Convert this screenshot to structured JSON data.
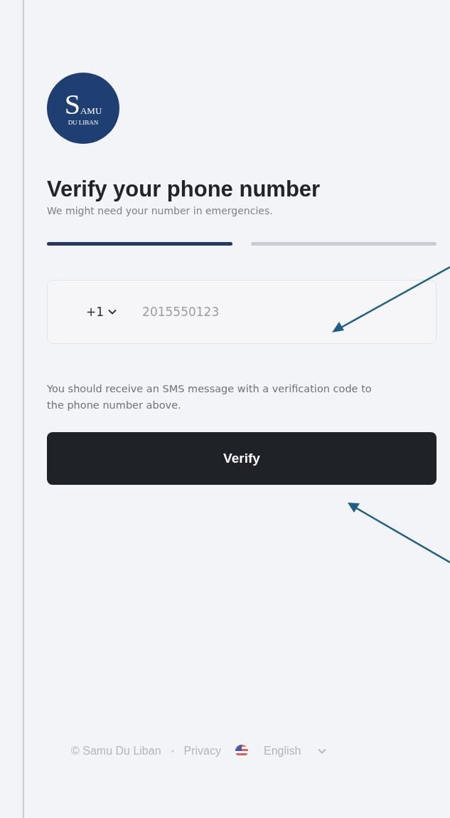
{
  "logo": {
    "initial": "S",
    "text": "AMU",
    "subtext": "DU LIBAN"
  },
  "title": "Verify your phone number",
  "subtitle": "We might need your number in emergencies.",
  "steps": [
    {
      "active": true
    },
    {
      "active": false
    }
  ],
  "phone_field": {
    "country_code": "+1",
    "placeholder": "2015550123"
  },
  "helper_text": "You should receive an SMS message with a verification code to the phone number above.",
  "verify_button": "Verify",
  "footer": {
    "copyright": "© Samu Du Liban",
    "privacy_link": "Privacy",
    "language": "English"
  }
}
